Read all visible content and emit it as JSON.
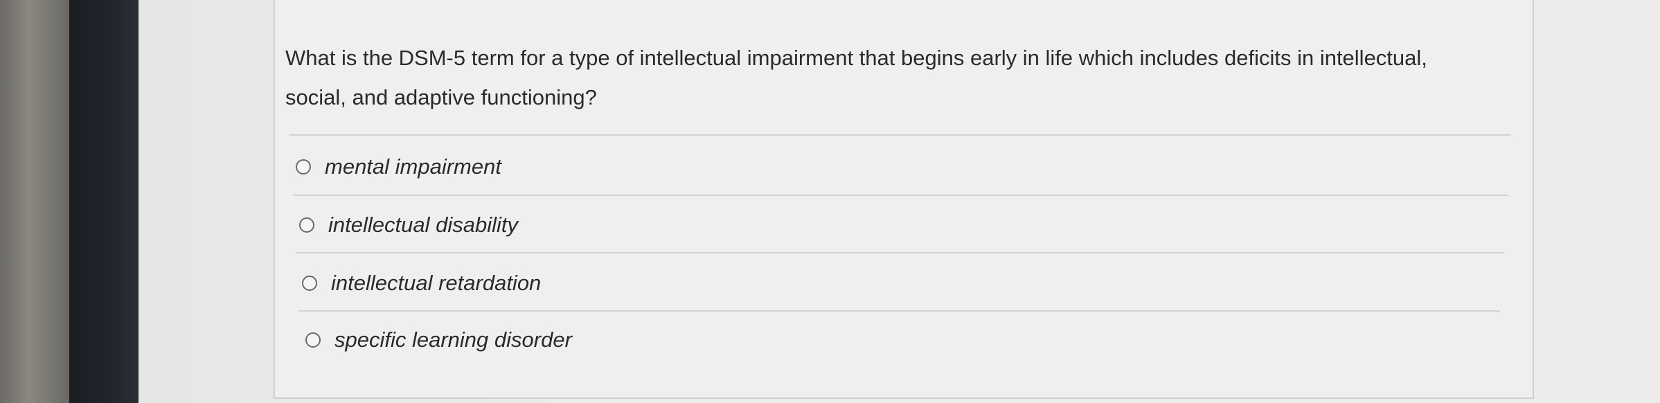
{
  "question": {
    "text": "What is the DSM-5 term for a type of intellectual impairment that begins early in life which includes deficits in intellectual, social, and adaptive functioning?"
  },
  "options": [
    {
      "label": "mental impairment",
      "selected": false
    },
    {
      "label": "intellectual disability",
      "selected": false
    },
    {
      "label": "intellectual retardation",
      "selected": false
    },
    {
      "label": "specific learning disorder",
      "selected": false
    }
  ],
  "colors": {
    "card_background": "#efefed",
    "text": "#2a2a2a",
    "divider": "#d2d2cf"
  }
}
